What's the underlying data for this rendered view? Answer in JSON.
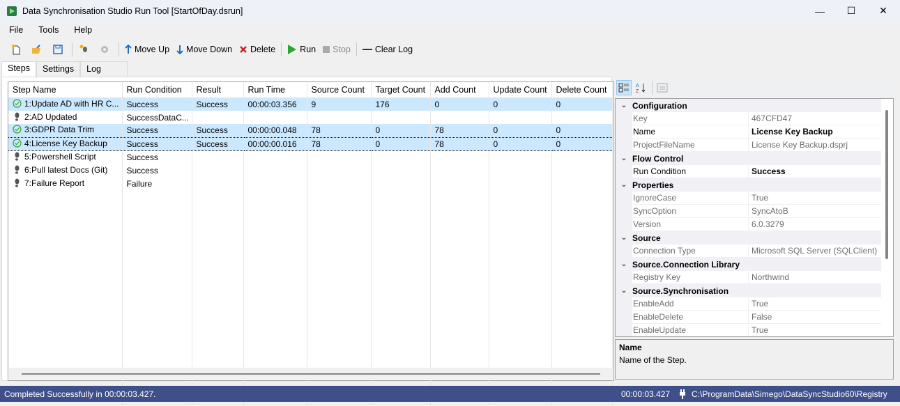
{
  "window": {
    "title": "Data Synchronisation Studio Run Tool [StartOfDay.dsrun]",
    "controls": {
      "minimize": "—",
      "maximize": "☐",
      "close": "✕"
    }
  },
  "menu": [
    "File",
    "Tools",
    "Help"
  ],
  "toolbar": {
    "icons": [
      "new-file-icon",
      "open-folder-icon",
      "save-icon",
      "add-step-icon",
      "settings-gear-icon"
    ],
    "move_up": "Move Up",
    "move_down": "Move Down",
    "delete": "Delete",
    "run": "Run",
    "stop": "Stop",
    "clear_log": "Clear Log"
  },
  "tabs": [
    "Steps",
    "Settings",
    "Log"
  ],
  "steps_grid": {
    "columns": [
      "Step Name",
      "Run Condition",
      "Result",
      "Run Time",
      "Source Count",
      "Target Count",
      "Add Count",
      "Update Count",
      "Delete Count"
    ],
    "rows": [
      {
        "status": "success",
        "name": "1:Update AD with HR C...",
        "condition": "Success",
        "result": "Success",
        "time": "00:00:03.356",
        "source": "9",
        "target": "176",
        "add": "0",
        "update": "0",
        "delete": "0",
        "selected": true
      },
      {
        "status": "pending",
        "name": "2:AD Updated",
        "condition": "SuccessDataC...",
        "result": "",
        "time": "",
        "source": "",
        "target": "",
        "add": "",
        "update": "",
        "delete": "",
        "selected": false
      },
      {
        "status": "success",
        "name": "3:GDPR Data Trim",
        "condition": "Success",
        "result": "Success",
        "time": "00:00:00.048",
        "source": "78",
        "target": "0",
        "add": "78",
        "update": "0",
        "delete": "0",
        "selected": true
      },
      {
        "status": "success",
        "name": "4:License Key Backup",
        "condition": "Success",
        "result": "Success",
        "time": "00:00:00.016",
        "source": "78",
        "target": "0",
        "add": "78",
        "update": "0",
        "delete": "0",
        "selected": true
      },
      {
        "status": "pending",
        "name": "5:Powershell Script",
        "condition": "Success",
        "result": "",
        "time": "",
        "source": "",
        "target": "",
        "add": "",
        "update": "",
        "delete": "",
        "selected": false
      },
      {
        "status": "pending",
        "name": "6:Pull latest Docs (Git)",
        "condition": "Success",
        "result": "",
        "time": "",
        "source": "",
        "target": "",
        "add": "",
        "update": "",
        "delete": "",
        "selected": false
      },
      {
        "status": "pending",
        "name": "7:Failure Report",
        "condition": "Failure",
        "result": "",
        "time": "",
        "source": "",
        "target": "",
        "add": "",
        "update": "",
        "delete": "",
        "selected": false
      }
    ]
  },
  "property_grid": {
    "toolbar": [
      "categorized-icon",
      "alphabetical-sort-icon",
      "property-pages-icon"
    ],
    "rows": [
      {
        "type": "cat",
        "label": "Configuration"
      },
      {
        "type": "prop",
        "key": "Key",
        "value": "467CFD47",
        "editable": false
      },
      {
        "type": "prop",
        "key": "Name",
        "value": "License Key Backup",
        "editable": true,
        "bold": true
      },
      {
        "type": "prop",
        "key": "ProjectFileName",
        "value": "License Key Backup.dsprj",
        "editable": false
      },
      {
        "type": "cat",
        "label": "Flow Control"
      },
      {
        "type": "prop",
        "key": "Run Condition",
        "value": "Success",
        "editable": true,
        "bold": true
      },
      {
        "type": "cat",
        "label": "Properties"
      },
      {
        "type": "prop",
        "key": "IgnoreCase",
        "value": "True",
        "editable": false
      },
      {
        "type": "prop",
        "key": "SyncOption",
        "value": "SyncAtoB",
        "editable": false
      },
      {
        "type": "prop",
        "key": "Version",
        "value": "6.0.3279",
        "editable": false
      },
      {
        "type": "cat",
        "label": "Source"
      },
      {
        "type": "prop",
        "key": "Connection Type",
        "value": "Microsoft SQL Server (SQLClient)",
        "editable": false
      },
      {
        "type": "cat",
        "label": "Source.Connection Library"
      },
      {
        "type": "prop",
        "key": "Registry Key",
        "value": "Northwind",
        "editable": false
      },
      {
        "type": "cat",
        "label": "Source.Synchronisation"
      },
      {
        "type": "prop",
        "key": "EnableAdd",
        "value": "True",
        "editable": false
      },
      {
        "type": "prop",
        "key": "EnableDelete",
        "value": "False",
        "editable": false
      },
      {
        "type": "prop",
        "key": "EnableUpdate",
        "value": "True",
        "editable": false
      }
    ],
    "description": {
      "title": "Name",
      "text": "Name of the Step."
    }
  },
  "status": {
    "message": "Completed Successfully in 00:00:03.427.",
    "elapsed": "00:00:03.427",
    "registry_path": "C:\\ProgramData\\Simego\\DataSyncStudio60\\Registry"
  },
  "colors": {
    "selection": "#cce8ff",
    "statusbar": "#3f4f8a",
    "run_green": "#2fa52f",
    "delete_red": "#d81e1e",
    "arrow_blue": "#1e6fc6"
  }
}
